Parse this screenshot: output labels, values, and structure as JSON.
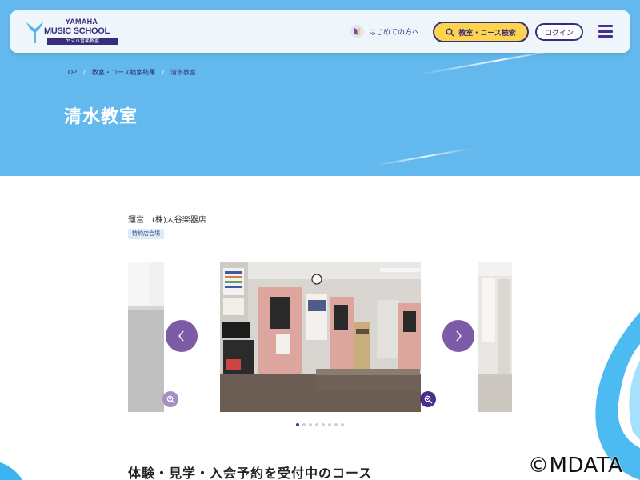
{
  "header": {
    "logo_line1": "YAMAHA",
    "logo_line2": "MUSIC SCHOOL",
    "logo_sub": "ヤマハ音楽教室",
    "nav_first_time": "はじめての方へ",
    "search_button": "教室・コース検索",
    "login_button": "ログイン",
    "menu_icon": "hamburger-menu-icon"
  },
  "breadcrumb": {
    "items": [
      "TOP",
      "教室・コース検索結果",
      "清水教室"
    ],
    "separator": "/"
  },
  "page": {
    "title": "清水教室",
    "operator": "運営：(株)大谷楽器店",
    "tag": "特約店会場"
  },
  "carousel": {
    "total_slides": 8,
    "active_index": 0,
    "prev_icon": "chevron-left-icon",
    "next_icon": "chevron-right-icon",
    "zoom_icon": "zoom-in-icon"
  },
  "section": {
    "title": "体験・見学・入会予約を受付中のコース"
  },
  "watermark": "©MDATA",
  "colors": {
    "hero_bg": "#63b9ee",
    "brand_purple": "#3a2c7a",
    "accent_yellow": "#fcd44d",
    "arrow_purple": "#7c5aa6"
  }
}
